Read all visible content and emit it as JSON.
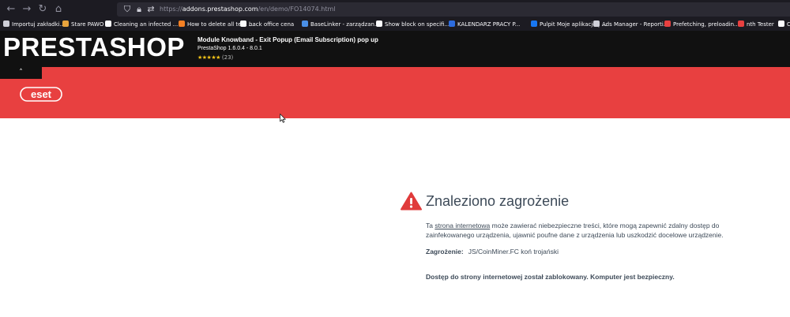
{
  "browser": {
    "url_prefix": "https://",
    "url_host": "addons.prestashop.com",
    "url_path": "/en/demo/FO14074.html",
    "bookmarks": [
      {
        "label": "Importuj zakładki...",
        "color": "#cfcfd8"
      },
      {
        "label": "Stare PAWO",
        "color": "#e8a33d"
      },
      {
        "label": "Cleaning an infected ...",
        "color": "#fbfbfe"
      },
      {
        "label": "How to delete all text ...",
        "color": "#f48024"
      },
      {
        "label": "back office cena",
        "color": "#fbfbfe"
      },
      {
        "label": "BaseLinker - zarządzan...",
        "color": "#4a8fe7"
      },
      {
        "label": "Show block on specifi...",
        "color": "#fbfbfe"
      },
      {
        "label": "KALENDARZ PRACY P...",
        "color": "#2d6cdf"
      },
      {
        "label": "Pulpit Moje aplikacje | ...",
        "color": "#1877f2"
      },
      {
        "label": "Ads Manager - Reporti...",
        "color": "#cfcfd8"
      },
      {
        "label": "Prefetching, preloadin...",
        "color": "#e84040"
      },
      {
        "label": "nth Tester",
        "color": "#e84040"
      },
      {
        "label": "C",
        "color": "#fbfbfe"
      }
    ]
  },
  "prestashop": {
    "logo": "PRESTASHOP",
    "module_title": "Module Knowband - Exit Popup (Email Subscription) pop up",
    "version": "PrestaShop 1.6.0.4 - 8.0.1",
    "stars": "★★★★★",
    "rating": 5,
    "review_count": "(23)"
  },
  "eset": {
    "logo_text": "eset",
    "brand_color": "#e84040",
    "title": "Znaleziono zagrożenie",
    "body_prefix": "Ta ",
    "body_link": "strona internetowa",
    "body_suffix": " może zawierać niebezpieczne treści, które mogą zapewnić zdalny dostęp do zainfekowanego urządzenia, ujawnić poufne dane z urządzenia lub uszkodzić docelowe urządzenie.",
    "threat_label": "Zagrożenie:",
    "threat_value": "JS/CoinMiner.FC koń trojański",
    "blocked_message": "Dostęp do strony internetowej został zablokowany. Komputer jest bezpieczny."
  }
}
